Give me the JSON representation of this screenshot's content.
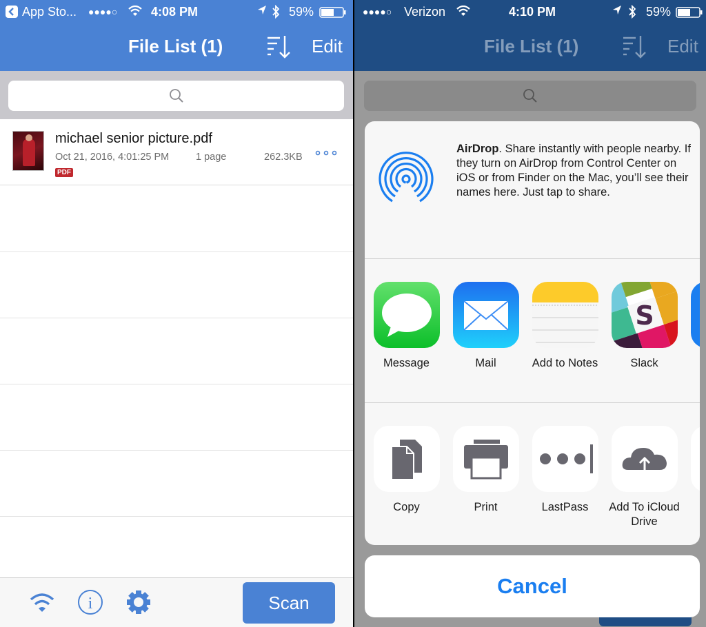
{
  "left_screen": {
    "status": {
      "back_app": "App Sto...",
      "signal": "●●●●○",
      "time": "4:08 PM",
      "battery": "59%"
    },
    "nav": {
      "title": "File List (1)",
      "edit_label": "Edit"
    },
    "search": {
      "placeholder": ""
    },
    "files": [
      {
        "name": "michael senior picture.pdf",
        "date": "Oct 21, 2016, 4:01:25 PM",
        "pages": "1 page",
        "size": "262.3KB",
        "type_badge": "PDF"
      }
    ],
    "toolbar": {
      "scan_label": "Scan"
    },
    "colors": {
      "accent": "#4a82d4",
      "badge": "#c0282e"
    }
  },
  "right_screen": {
    "status": {
      "signal": "●●●●○",
      "carrier": "Verizon",
      "time": "4:10 PM",
      "battery": "59%"
    },
    "nav": {
      "title": "File List (1)",
      "edit_label": "Edit"
    },
    "share_sheet": {
      "airdrop_title": "AirDrop",
      "airdrop_text": ". Share instantly with people nearby. If they turn on AirDrop from Control Center on iOS or from Finder on the Mac, you’ll see their names here. Just tap to share.",
      "apps": [
        {
          "label": "Message",
          "icon": "messages-icon"
        },
        {
          "label": "Mail",
          "icon": "mail-icon"
        },
        {
          "label": "Add to Notes",
          "icon": "notes-icon"
        },
        {
          "label": "Slack",
          "icon": "slack-icon"
        }
      ],
      "actions": [
        {
          "label": "Copy",
          "icon": "copy-icon"
        },
        {
          "label": "Print",
          "icon": "print-icon"
        },
        {
          "label": "LastPass",
          "icon": "lastpass-icon"
        },
        {
          "label": "Add To iCloud Drive",
          "icon": "icloud-upload-icon"
        }
      ],
      "cancel_label": "Cancel"
    },
    "colors": {
      "nav": "#1f4d84",
      "cancel": "#1a7ef0"
    }
  }
}
